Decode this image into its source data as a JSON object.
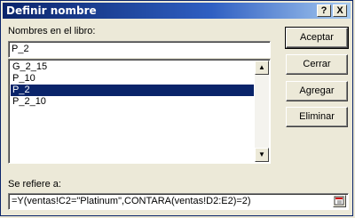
{
  "window": {
    "title": "Definir nombre",
    "help_glyph": "?",
    "close_glyph": "X"
  },
  "names_label": "Nombres en el libro:",
  "name_input": {
    "value": "P_2"
  },
  "names_list": [
    {
      "label": "G_2_15",
      "selected": false
    },
    {
      "label": "P_10",
      "selected": false
    },
    {
      "label": "P_2",
      "selected": true
    },
    {
      "label": "P_2_10",
      "selected": false
    }
  ],
  "buttons": {
    "accept": "Aceptar",
    "close": "Cerrar",
    "add": "Agregar",
    "delete": "Eliminar"
  },
  "refers_label": "Se refiere a:",
  "refers_value": "=Y(ventas!C2=\"Platinum\",CONTARA(ventas!D2:E2)=2)",
  "icons": {
    "up": "scroll-up-icon",
    "down": "scroll-down-icon",
    "collapse": "range-collapse-icon"
  },
  "colors": {
    "title_bar": "#0a246a",
    "selection": "#0a246a",
    "dialog_bg": "#ece9d8"
  }
}
